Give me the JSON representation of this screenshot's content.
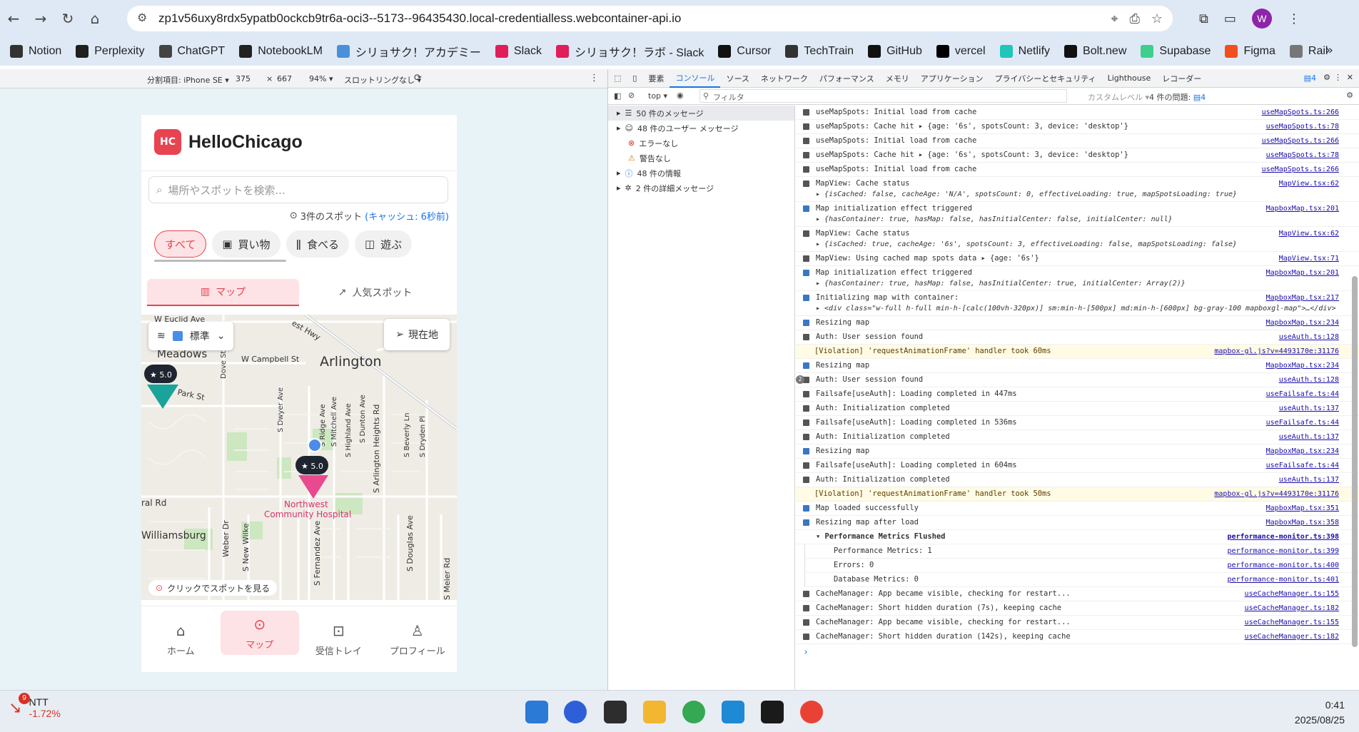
{
  "browser": {
    "url": "zp1v56uxy8rdx5ypatb0ockcb9tr6a-oci3--5173--96435430.local-credentialless.webcontainer-api.io",
    "profile_initial": "W",
    "bookmarks": [
      {
        "label": "Notion",
        "color": "#333333"
      },
      {
        "label": "Perplexity",
        "color": "#1f1f1f"
      },
      {
        "label": "ChatGPT",
        "color": "#444444"
      },
      {
        "label": "NotebookLM",
        "color": "#222222"
      },
      {
        "label": "シリョサク！アカデミー",
        "color": "#4a90d9"
      },
      {
        "label": "Slack",
        "color": "#e01e5a"
      },
      {
        "label": "シリョサク！ラボ - Slack",
        "color": "#e01e5a"
      },
      {
        "label": "Cursor",
        "color": "#111111"
      },
      {
        "label": "TechTrain",
        "color": "#333333"
      },
      {
        "label": "GitHub",
        "color": "#111111"
      },
      {
        "label": "vercel",
        "color": "#000000"
      },
      {
        "label": "Netlify",
        "color": "#20c6b7"
      },
      {
        "label": "Bolt.new",
        "color": "#111111"
      },
      {
        "label": "Supabase",
        "color": "#3ecf8e"
      },
      {
        "label": "Figma",
        "color": "#f24e1e"
      },
      {
        "label": "Rail",
        "color": "#777777"
      }
    ]
  },
  "emulation": {
    "device": "分割項目: iPhone SE ▾",
    "width": "375",
    "x": "×",
    "height": "667",
    "zoom": "94% ▾",
    "throttle": "スロットリングなし ▾"
  },
  "app": {
    "logo": "HC",
    "title": "HelloChicago",
    "search_placeholder": "場所やスポットを検索...",
    "spot_count": "3件のスポット",
    "cache_info": "(キャッシュ: 6秒前)",
    "categories": [
      "すべて",
      "買い物",
      "食べる",
      "遊ぶ"
    ],
    "tabs": [
      "マップ",
      "人気スポット"
    ],
    "map_style": "標準",
    "current_location": "現在地",
    "map_hint": "クリックでスポットを見る",
    "map_labels": {
      "euclid": "W Euclid Ave",
      "hwy": "est Hwy",
      "meadows": "Meadows",
      "campbell": "W Campbell St",
      "arlington1": "Arlington",
      "arlington2": "Heights",
      "park": "Park St",
      "dove": "Dove St",
      "dwyer": "S Dwyer Ave",
      "ridge": "S Ridge Ave",
      "mitchell": "S Mitchell Ave",
      "highland": "S Highland Ave",
      "dunton": "S Dunton Ave",
      "arlhts": "S Arlington Heights Rd",
      "beverly": "S Beverly Ln",
      "dryden": "S Dryden Pl",
      "rd": "ral Rd",
      "williamsburg": "Williamsburg",
      "weber": "Weber Dr",
      "wilke": "S New Wilke",
      "fernandez": "S Fernandez Ave",
      "douglas": "S Douglas Ave",
      "meier": "S Meier Rd",
      "hospital1": "Northwest",
      "hospital2": "Community Hospital"
    },
    "pins": [
      {
        "rating": "★ 5.0",
        "color": "#1aa39a"
      },
      {
        "rating": "★ 5.0",
        "color": "#e8498f"
      }
    ],
    "bottom_nav": [
      "ホーム",
      "マップ",
      "受信トレイ",
      "プロフィール"
    ]
  },
  "devtools": {
    "tabs": [
      "要素",
      "コンソール",
      "ソース",
      "ネットワーク",
      "パフォーマンス",
      "メモリ",
      "アプリケーション",
      "プライバシーとセキュリティ",
      "Lighthouse",
      "レコーダー"
    ],
    "badge": "4",
    "context": "top ▾",
    "filter_placeholder": "フィルタ",
    "levels": "カスタムレベル ▾",
    "issues": "4 件の問題:",
    "issues_count": "4",
    "sidebar": [
      "50 件のメッセージ",
      "48 件のユーザー メッセージ",
      "エラーなし",
      "警告なし",
      "48 件の情報",
      "2 件の詳細メッセージ"
    ],
    "logs": [
      {
        "text": "useMapSpots: Initial load from cache",
        "src": "useMapSpots.ts:266",
        "kind": "log"
      },
      {
        "text": "useMapSpots: Cache hit  ▸ {age: '6s', spotsCount: 3, device: 'desktop'}",
        "src": "useMapSpots.ts:78",
        "kind": "log"
      },
      {
        "text": "useMapSpots: Initial load from cache",
        "src": "useMapSpots.ts:266",
        "kind": "log"
      },
      {
        "text": "useMapSpots: Cache hit  ▸ {age: '6s', spotsCount: 3, device: 'desktop'}",
        "src": "useMapSpots.ts:78",
        "kind": "log"
      },
      {
        "text": "useMapSpots: Initial load from cache",
        "src": "useMapSpots.ts:266",
        "kind": "log"
      },
      {
        "text": "MapView: Cache status",
        "sub": "▸ {isCached: false, cacheAge: 'N/A', spotsCount: 0, effectiveLoading: true, mapSpotsLoading: true}",
        "src": "MapView.tsx:62",
        "kind": "log"
      },
      {
        "text": "Map initialization effect triggered",
        "sub": "▸ {hasContainer: true, hasMap: false, hasInitialCenter: false, initialCenter: null}",
        "src": "MapboxMap.tsx:201",
        "kind": "info"
      },
      {
        "text": "MapView: Cache status",
        "sub": "▸ {isCached: true, cacheAge: '6s', spotsCount: 3, effectiveLoading: false, mapSpotsLoading: false}",
        "src": "MapView.tsx:62",
        "kind": "log"
      },
      {
        "text": "MapView: Using cached map spots data  ▸ {age: '6s'}",
        "src": "MapView.tsx:71",
        "kind": "log"
      },
      {
        "text": "Map initialization effect triggered",
        "sub": "▸ {hasContainer: true, hasMap: false, hasInitialCenter: true, initialCenter: Array(2)}",
        "src": "MapboxMap.tsx:201",
        "kind": "info"
      },
      {
        "text": "Initializing map with container:",
        "sub": "▸ <div class=\"w-full h-full min-h-[calc(100vh-320px)] sm:min-h-[500px] md:min-h-[600px] bg-gray-100 mapboxgl-map\">…</div>",
        "src": "MapboxMap.tsx:217",
        "kind": "info"
      },
      {
        "text": "Resizing map",
        "src": "MapboxMap.tsx:234",
        "kind": "info"
      },
      {
        "text": "Auth: User session found",
        "src": "useAuth.ts:128",
        "kind": "log"
      },
      {
        "text": "[Violation] 'requestAnimationFrame' handler took 60ms",
        "src": "mapbox-gl.js?v=4493170e:31176",
        "kind": "warn"
      },
      {
        "text": "Resizing map",
        "src": "MapboxMap.tsx:234",
        "kind": "info"
      },
      {
        "text": "Auth: User session found",
        "src": "useAuth.ts:128",
        "kind": "log",
        "count": "2"
      },
      {
        "text": "Failsafe[useAuth]: Loading completed in 447ms",
        "src": "useFailsafe.ts:44",
        "kind": "log"
      },
      {
        "text": "Auth: Initialization completed",
        "src": "useAuth.ts:137",
        "kind": "log"
      },
      {
        "text": "Failsafe[useAuth]: Loading completed in 536ms",
        "src": "useFailsafe.ts:44",
        "kind": "log"
      },
      {
        "text": "Auth: Initialization completed",
        "src": "useAuth.ts:137",
        "kind": "log"
      },
      {
        "text": "Resizing map",
        "src": "MapboxMap.tsx:234",
        "kind": "info"
      },
      {
        "text": "Failsafe[useAuth]: Loading completed in 604ms",
        "src": "useFailsafe.ts:44",
        "kind": "log"
      },
      {
        "text": "Auth: Initialization completed",
        "src": "useAuth.ts:137",
        "kind": "log"
      },
      {
        "text": "[Violation] 'requestAnimationFrame' handler took 50ms",
        "src": "mapbox-gl.js?v=4493170e:31176",
        "kind": "warn"
      },
      {
        "text": "Map loaded successfully",
        "src": "MapboxMap.tsx:351",
        "kind": "info"
      },
      {
        "text": "Resizing map after load",
        "src": "MapboxMap.tsx:358",
        "kind": "info"
      },
      {
        "text": "▾ Performance Metrics Flushed",
        "src": "performance-monitor.ts:398",
        "kind": "group"
      },
      {
        "text": "Performance Metrics: 1",
        "src": "performance-monitor.ts:399",
        "kind": "indent"
      },
      {
        "text": "Errors: 0",
        "src": "performance-monitor.ts:400",
        "kind": "indent"
      },
      {
        "text": "Database Metrics: 0",
        "src": "performance-monitor.ts:401",
        "kind": "indent"
      },
      {
        "text": "CacheManager: App became visible, checking for restart...",
        "src": "useCacheManager.ts:155",
        "kind": "log"
      },
      {
        "text": "CacheManager: Short hidden duration (7s), keeping cache",
        "src": "useCacheManager.ts:182",
        "kind": "log"
      },
      {
        "text": "CacheManager: App became visible, checking for restart...",
        "src": "useCacheManager.ts:155",
        "kind": "log"
      },
      {
        "text": "CacheManager: Short hidden duration (142s), keeping cache",
        "src": "useCacheManager.ts:182",
        "kind": "log"
      }
    ],
    "prompt": "›"
  },
  "taskbar": {
    "badge": "9",
    "stock_name": "NTT",
    "stock_change": "-1.72%",
    "time": "0:41",
    "date": "2025/08/25"
  }
}
